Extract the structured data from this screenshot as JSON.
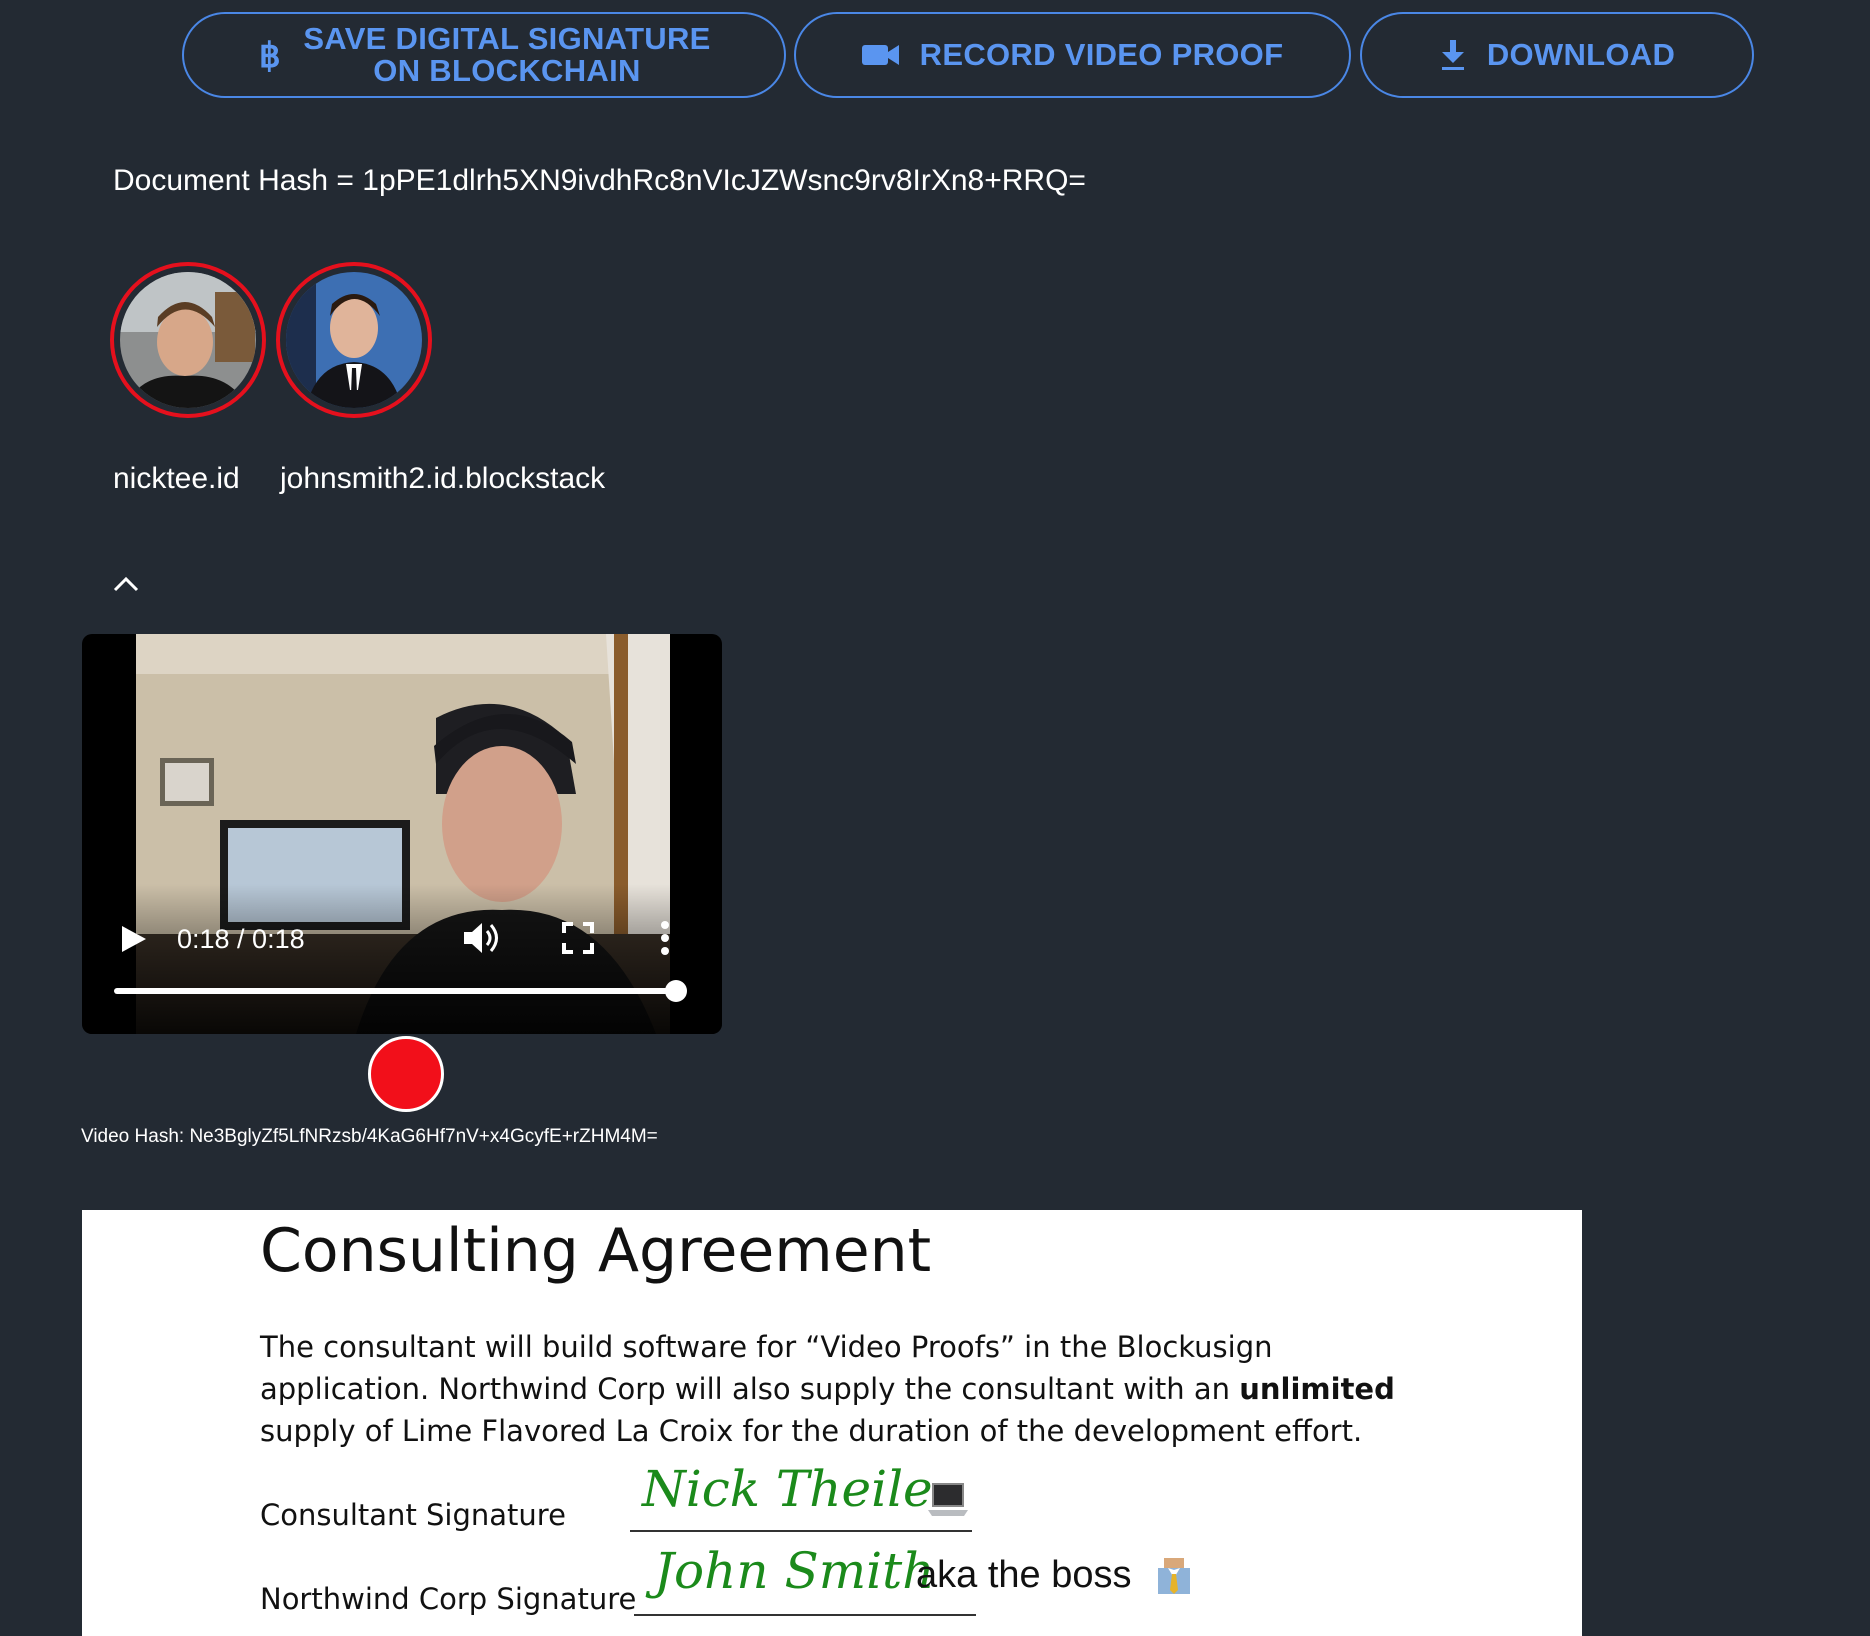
{
  "toolbar": {
    "save_label_line1": "SAVE DIGITAL SIGNATURE",
    "save_label_line2": "ON BLOCKCHAIN",
    "record_label": "RECORD VIDEO PROOF",
    "download_label": "DOWNLOAD",
    "accent_color": "#5a95f0"
  },
  "document_hash": "Document Hash = 1pPE1dlrh5XN9ivdhRc8nVIcJZWsnc9rv8IrXn8+RRQ=",
  "signers": [
    {
      "username": "nicktee.id"
    },
    {
      "username": "johnsmith2.id.blockstack"
    }
  ],
  "video": {
    "time": "0:18 / 0:18",
    "progress": 1.0
  },
  "video_hash": "Video Hash: Ne3BglyZf5LfNRzsb/4KaG6Hf7nV+x4GcyfE+rZHM4M=",
  "document": {
    "title": "Consulting Agreement",
    "line1": "The consultant will build software for “Video Proofs” in the Blockusign",
    "line2_pre": "application. Northwind Corp will also supply the consultant with an ",
    "line2_bold": "unlimited",
    "line3": "supply of Lime Flavored La Croix for the duration of the development effort.",
    "consultant_label": "Consultant Signature",
    "consultant_signature": "Nick Theile",
    "northwind_label": "Northwind Corp Signature",
    "northwind_signature": "John Smith",
    "boss_note": "aka the boss",
    "signature_color": "#1b8a1b"
  },
  "colors": {
    "background": "#232a33",
    "avatar_ring": "#e5101d",
    "record": "#f20f1a"
  }
}
